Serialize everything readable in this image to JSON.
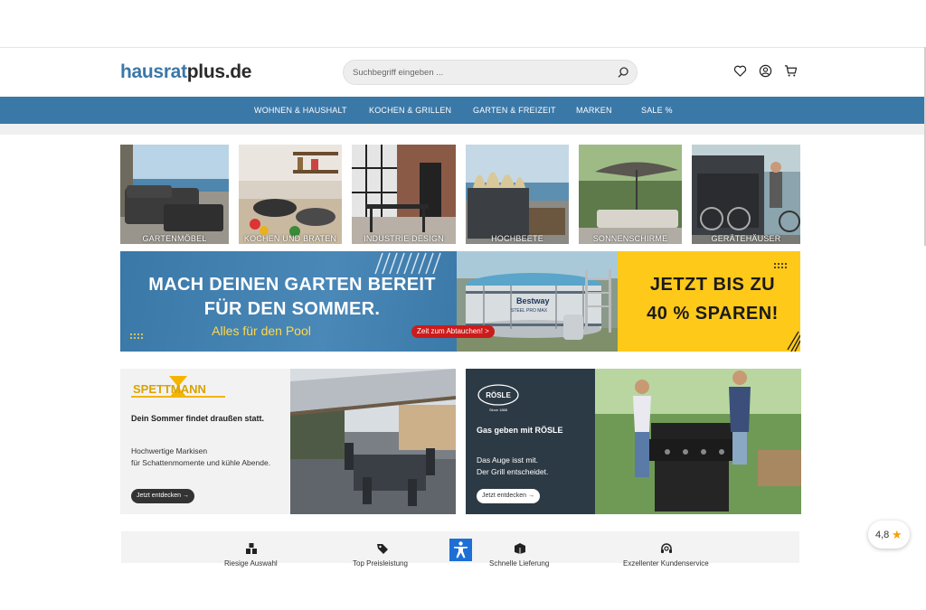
{
  "header": {
    "logo_part1": "hausrat",
    "logo_part2": "plus.de",
    "search_placeholder": "Suchbegriff eingeben ...",
    "icons": [
      "search-icon",
      "heart-icon",
      "account-icon",
      "cart-icon"
    ]
  },
  "nav": {
    "items": [
      "WOHNEN & HAUSHALT",
      "KOCHEN & GRILLEN",
      "GARTEN & FREIZEIT",
      "MARKEN",
      "SALE %"
    ]
  },
  "categories": [
    "GARTENMÖBEL",
    "KOCHEN UND BRATEN",
    "INDUSTRIE DESIGN",
    "HOCHBEETE",
    "SONNENSCHIRME",
    "GERÄTEHÄUSER"
  ],
  "banner": {
    "line1": "MACH DEINEN GARTEN BEREIT",
    "line2": "FÜR DEN SOMMER.",
    "sub": "Alles für den Pool",
    "cta": "Zeit zum Abtauchen! >",
    "right1": "JETZT BIS ZU",
    "right2": "40 % SPAREN!",
    "pool_brand": "Bestway",
    "pool_model": "STEEL PRO MAX"
  },
  "promo_left": {
    "brand": "SPETTMANN",
    "headline": "Dein Sommer findet draußen statt.",
    "desc1": "Hochwertige Markisen",
    "desc2": "für Schattenmomente und kühle Abende.",
    "button": "Jetzt entdecken"
  },
  "promo_right": {
    "brand": "RÖSLE",
    "brand_since": "Since 1888",
    "headline": "Gas geben mit RÖSLE",
    "desc1": "Das Auge isst mit.",
    "desc2": "Der Grill entscheidet.",
    "button": "Jetzt entdecken"
  },
  "usp": {
    "items": [
      "Riesige Auswahl",
      "Top Preisleistung",
      "Schnelle Lieferung",
      "Exzellenter Kundenservice"
    ]
  },
  "rating": {
    "value": "4,8"
  },
  "colors": {
    "brand_blue": "#3a78a8",
    "banner_yellow": "#ffc91a",
    "cta_red": "#cc1b1b",
    "rosle_dark": "#2c3a45",
    "spettmann_yellow": "#f5b400"
  }
}
